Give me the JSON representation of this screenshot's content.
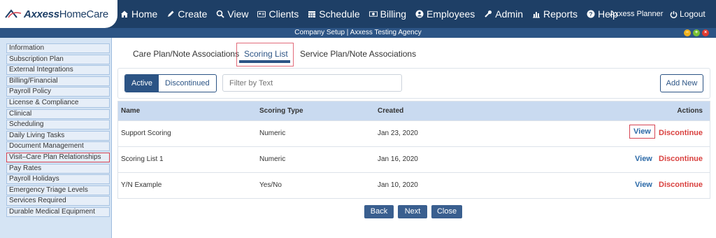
{
  "brand": {
    "logo_bold": "Axxess",
    "logo_light": "HomeCare"
  },
  "nav": [
    {
      "label": "Home",
      "icon": "home-icon"
    },
    {
      "label": "Create",
      "icon": "pencil-icon"
    },
    {
      "label": "View",
      "icon": "search-icon"
    },
    {
      "label": "Clients",
      "icon": "id-card-icon"
    },
    {
      "label": "Schedule",
      "icon": "calendar-icon"
    },
    {
      "label": "Billing",
      "icon": "money-icon"
    },
    {
      "label": "Employees",
      "icon": "user-circle-icon"
    },
    {
      "label": "Admin",
      "icon": "wrench-icon"
    },
    {
      "label": "Reports",
      "icon": "bar-chart-icon"
    },
    {
      "label": "Help",
      "icon": "question-icon"
    }
  ],
  "user": {
    "name": "Axxess Planner",
    "logout": "Logout"
  },
  "window": {
    "title": "Company Setup | Axxess Testing Agency"
  },
  "sidebar": {
    "items": [
      "Information",
      "Subscription Plan",
      "External Integrations",
      "Billing/Financial",
      "Payroll Policy",
      "License & Compliance",
      "Clinical",
      "Scheduling",
      "Daily Living Tasks",
      "Document Management",
      "Visit–Care Plan Relationships",
      "Pay Rates",
      "Payroll Holidays",
      "Emergency Triage Levels",
      "Services Required",
      "Durable Medical Equipment"
    ],
    "selected": 10
  },
  "tabs": {
    "care_plan": "Care Plan/Note Associations",
    "scoring": "Scoring List",
    "service_plan": "Service Plan/Note Associations"
  },
  "toolbar": {
    "active": "Active",
    "discontinued": "Discontinued",
    "filter_placeholder": "Filter by Text",
    "add_new": "Add New"
  },
  "table": {
    "headers": {
      "name": "Name",
      "type": "Scoring Type",
      "created": "Created",
      "actions": "Actions"
    },
    "rows": [
      {
        "name": "Support Scoring",
        "type": "Numeric",
        "created": "Jan 23, 2020",
        "view": "View",
        "discontinue": "Discontinue"
      },
      {
        "name": "Scoring List 1",
        "type": "Numeric",
        "created": "Jan 16, 2020",
        "view": "View",
        "discontinue": "Discontinue"
      },
      {
        "name": "Y/N Example",
        "type": "Yes/No",
        "created": "Jan 10, 2020",
        "view": "View",
        "discontinue": "Discontinue"
      }
    ]
  },
  "footer": {
    "back": "Back",
    "next": "Next",
    "close": "Close"
  },
  "colors": {
    "navy": "#1e3f66",
    "accent": "#2c5485",
    "danger": "#d9413f",
    "highlight": "#d64553"
  }
}
